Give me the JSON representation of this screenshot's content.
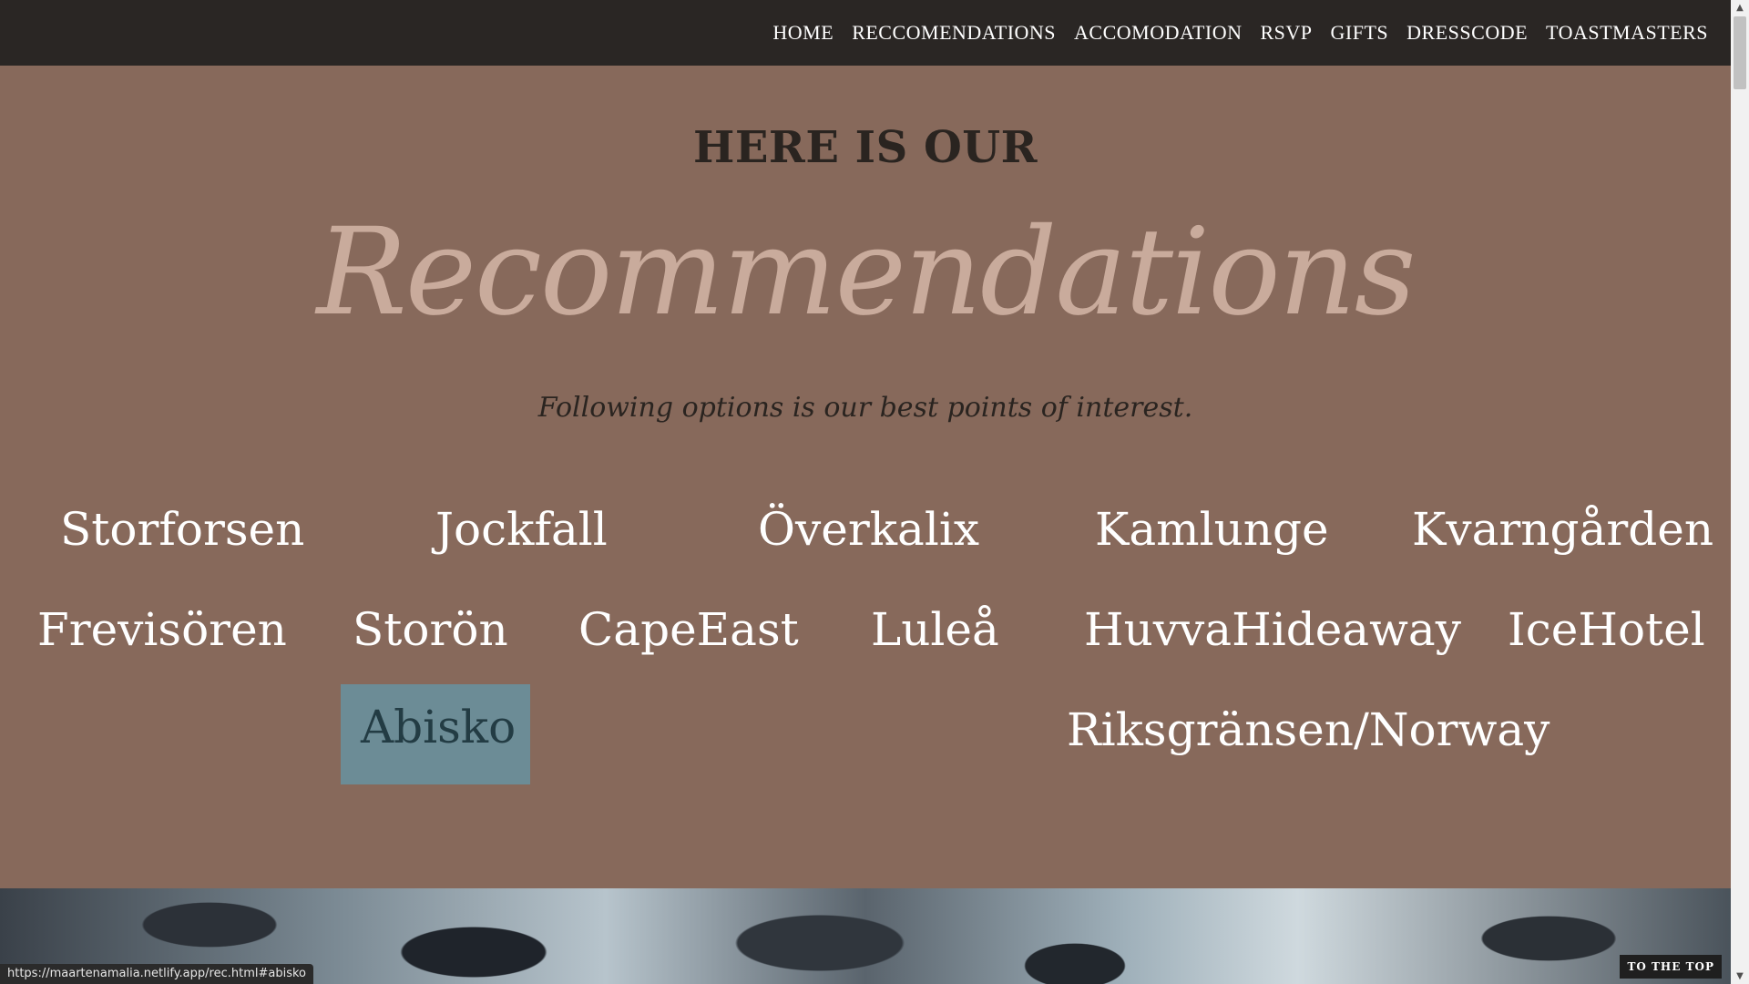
{
  "nav": {
    "items": [
      "HOME",
      "RECCOMENDATIONS",
      "ACCOMODATION",
      "RSVP",
      "GIFTS",
      "DRESSCODE",
      "TOASTMASTERS"
    ]
  },
  "header": {
    "pre_title": "HERE IS OUR",
    "script_title": "Recommendations",
    "subtitle": "Following options is our best points of interest."
  },
  "places": {
    "row1": [
      "Storforsen",
      "Jockfall",
      "Överkalix",
      "Kamlunge",
      "Kvarngården"
    ],
    "row2": [
      "Frevisören",
      "Storön",
      "CapeEast",
      "Luleå",
      "HuvvaHideaway",
      "IceHotel"
    ],
    "row3": [
      "Abisko",
      "Riksgränsen/Norway"
    ],
    "active": "Abisko"
  },
  "footer": {
    "status_url": "https://maartenamalia.netlify.app/rec.html#abisko",
    "to_top_label": "TO THE TOP"
  }
}
